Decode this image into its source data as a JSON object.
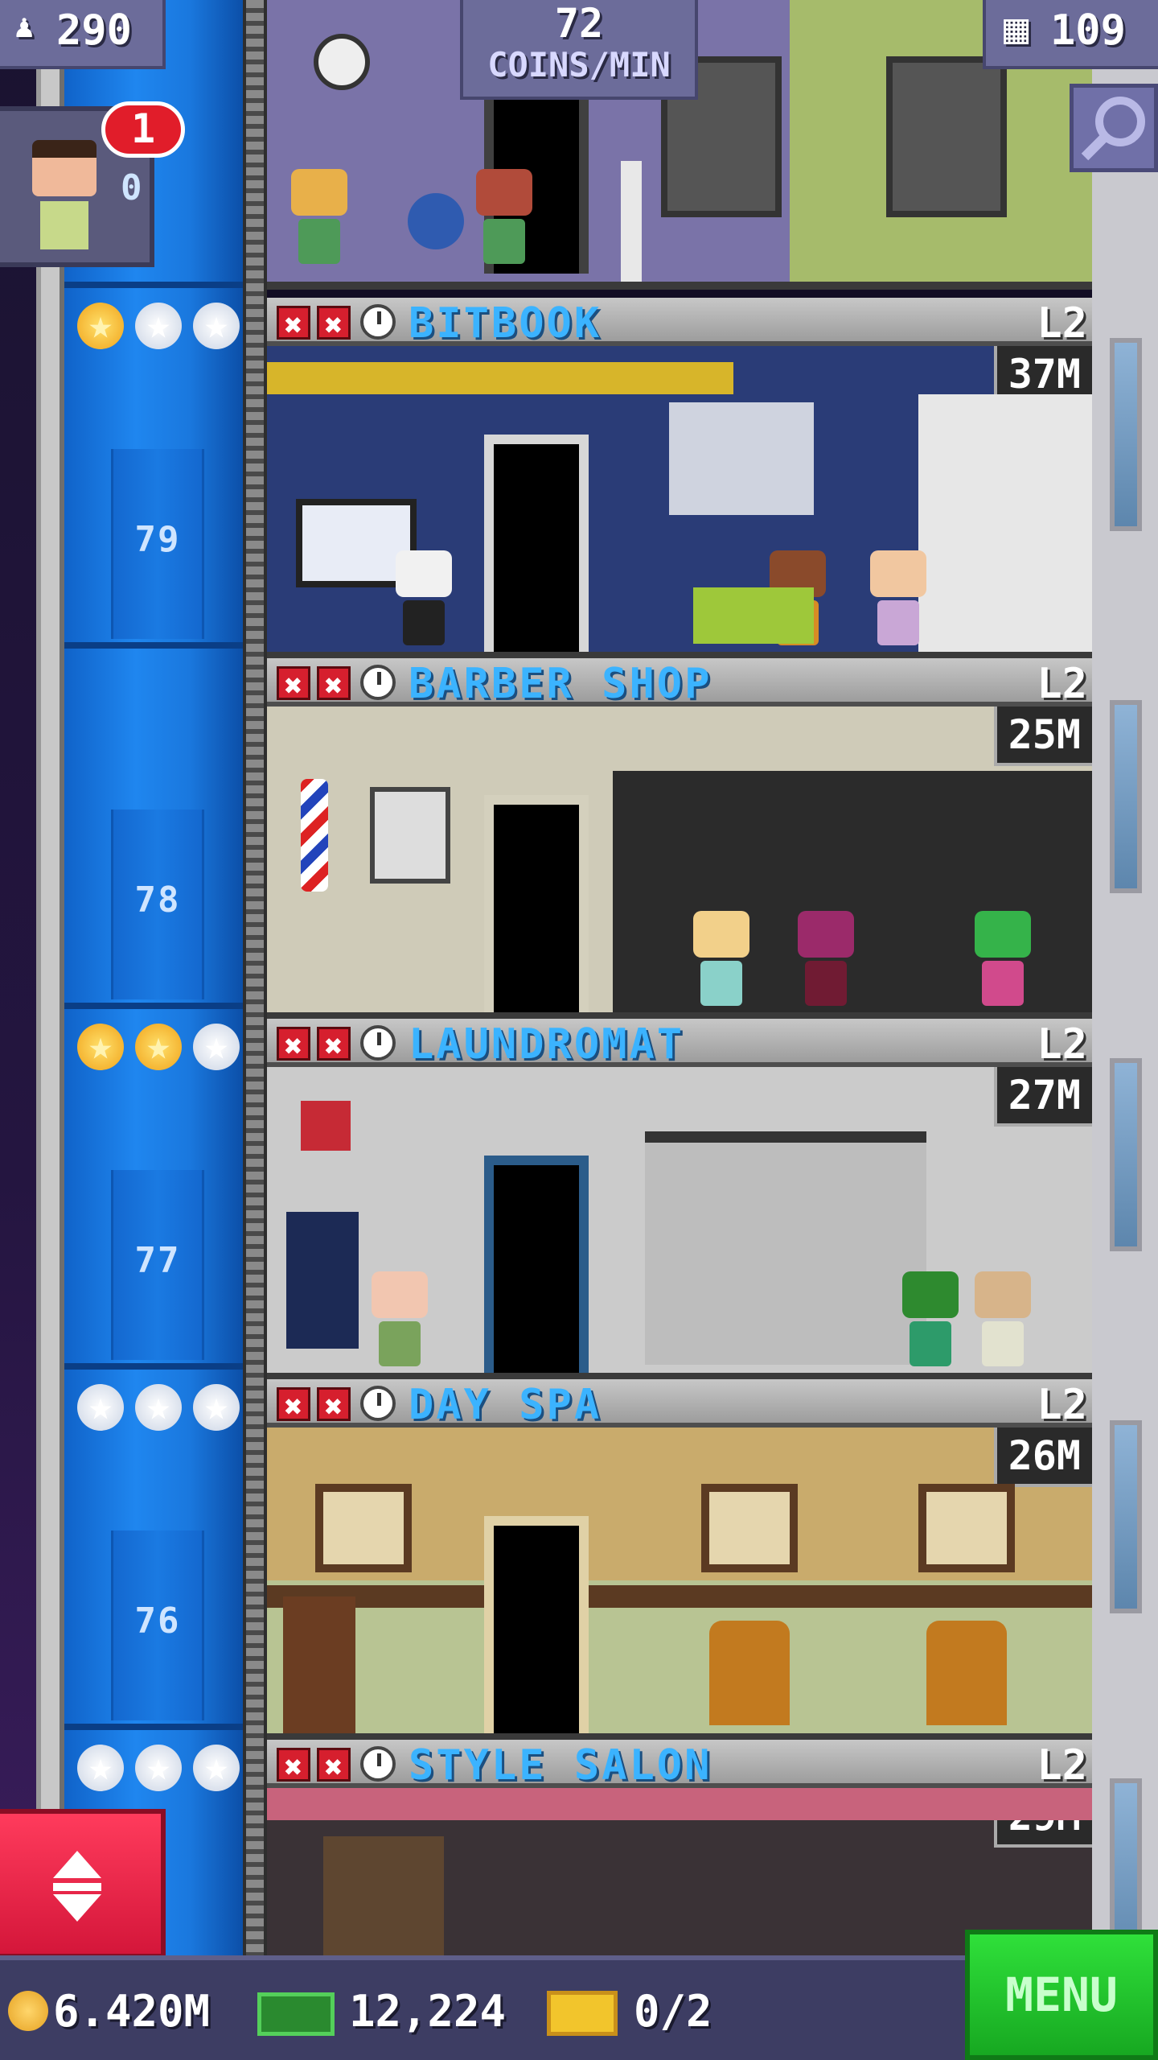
{
  "hud": {
    "population": "290",
    "coins_rate_value": "72",
    "coins_rate_unit": "COINS/MIN",
    "floors_count": "109"
  },
  "visitor": {
    "badge_count": "1",
    "floor_partial": "0"
  },
  "floors": [
    {
      "number": "79",
      "name": "BITBOOK",
      "level": "L2",
      "price": "37M",
      "stars": [
        "gold",
        "silver",
        "silver"
      ],
      "wall": "#2a3c77"
    },
    {
      "number": "78",
      "name": "BARBER SHOP",
      "level": "L2",
      "price": "25M",
      "stars": [],
      "wall": "#cfcbb8"
    },
    {
      "number": "77",
      "name": "LAUNDROMAT",
      "level": "L2",
      "price": "27M",
      "stars": [
        "gold",
        "gold",
        "silver"
      ],
      "wall": "#cbcbcb"
    },
    {
      "number": "76",
      "name": "DAY SPA",
      "level": "L2",
      "price": "26M",
      "stars": [
        "silver",
        "silver",
        "silver"
      ],
      "wall": "#c9ab6c"
    },
    {
      "number": "",
      "name": "STYLE SALON",
      "level": "L2",
      "price": "29M",
      "stars": [
        "silver",
        "silver",
        "silver"
      ],
      "wall": "#3a3236"
    }
  ],
  "bottom_bar": {
    "coins": "6.420M",
    "bux": "12,224",
    "tickets": "0/2",
    "menu_label": "MENU"
  },
  "colors": {
    "shaft_blue": "#1f86ef",
    "header_name": "#3bb3ff",
    "menu_green": "#17a821",
    "elevator_button_red": "#d4163a"
  }
}
